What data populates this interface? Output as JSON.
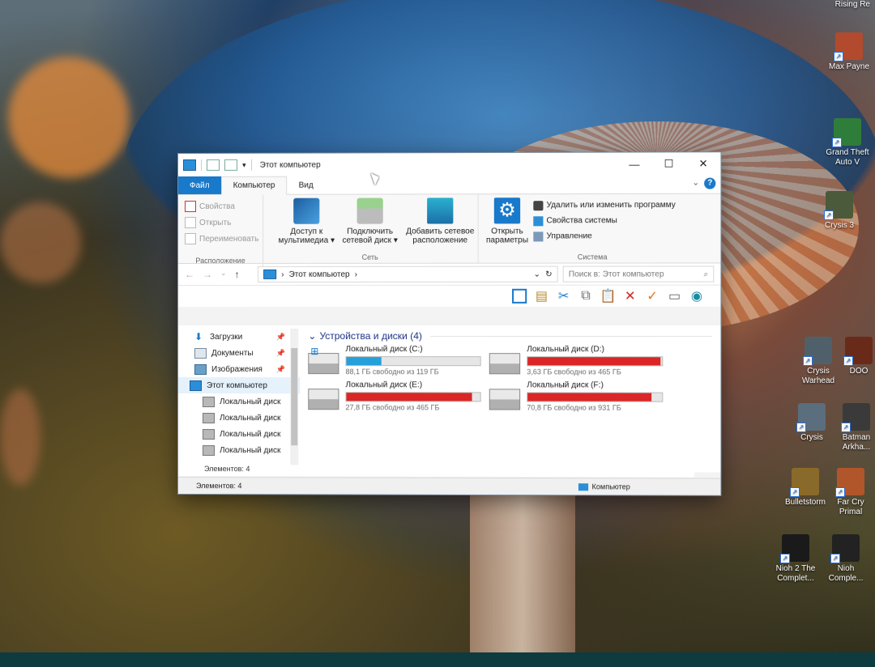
{
  "window": {
    "title": "Этот компьютер",
    "controls": {
      "minimize": "—",
      "maximize": "☐",
      "close": "✕"
    },
    "tabs": [
      "Файл",
      "Компьютер",
      "Вид"
    ]
  },
  "ribbon": {
    "location_group": {
      "label": "Расположение",
      "items": [
        "Свойства",
        "Открыть",
        "Переименовать"
      ]
    },
    "network_group": {
      "label": "Сеть",
      "media": "Доступ к\nмультимедиа ▾",
      "map_drive": "Подключить\nсетевой диск ▾",
      "add_location": "Добавить сетевое\nрасположение"
    },
    "open_settings": "Открыть\nпараметры",
    "system_group": {
      "label": "Система",
      "items": [
        "Удалить или изменить программу",
        "Свойства системы",
        "Управление"
      ]
    }
  },
  "address": {
    "path": "Этот компьютер",
    "search_placeholder": "Поиск в: Этот компьютер"
  },
  "navigation": {
    "items": [
      {
        "label": "Загрузки",
        "pinned": true
      },
      {
        "label": "Документы",
        "pinned": true
      },
      {
        "label": "Изображения",
        "pinned": true
      },
      {
        "label": "Этот компьютер",
        "selected": true
      },
      {
        "label": "Локальный диск"
      },
      {
        "label": "Локальный диск"
      },
      {
        "label": "Локальный диск"
      },
      {
        "label": "Локальный диск"
      }
    ]
  },
  "devices": {
    "header": "Устройства и диски (4)",
    "drives": [
      {
        "name": "Локальный диск (C:)",
        "free": "88,1 ГБ свободно из 119 ГБ",
        "used_fraction": 0.26,
        "color": "#26a0da"
      },
      {
        "name": "Локальный диск (D:)",
        "free": "3,63 ГБ свободно из 465 ГБ",
        "used_fraction": 0.99,
        "color": "#da2626"
      },
      {
        "name": "Локальный диск (E:)",
        "free": "27,8 ГБ свободно из 465 ГБ",
        "used_fraction": 0.94,
        "color": "#da2626"
      },
      {
        "name": "Локальный диск (F:)",
        "free": "70,8 ГБ свободно из 931 ГБ",
        "used_fraction": 0.92,
        "color": "#da2626"
      }
    ]
  },
  "status": {
    "items_count": "Элементов: 4",
    "items_count2": "Элементов: 4",
    "location": "Компьютер"
  },
  "desktop": {
    "icons": [
      {
        "label": "Max Payne",
        "color": "#b24a2e"
      },
      {
        "label": "Grand Theft Auto V",
        "color": "#2f7d3b"
      },
      {
        "label": "Crysis 3",
        "color": "#4a5a3a"
      },
      {
        "label": "Crysis Warhead",
        "color": "#50606a"
      },
      {
        "label": "DOO",
        "color": "#6a2a1a"
      },
      {
        "label": "Crysis",
        "color": "#5a6e7e"
      },
      {
        "label": "Batman Arkha...",
        "color": "#3a3a3a"
      },
      {
        "label": "Bulletstorm",
        "color": "#8a6a2a"
      },
      {
        "label": "Far Cry Primal",
        "color": "#b0562a"
      },
      {
        "label": "Nioh 2 The Complet...",
        "color": "#1a1a1a"
      },
      {
        "label": "Nioh Comple...",
        "color": "#222222"
      }
    ],
    "top_right_text": "Rising Re"
  }
}
